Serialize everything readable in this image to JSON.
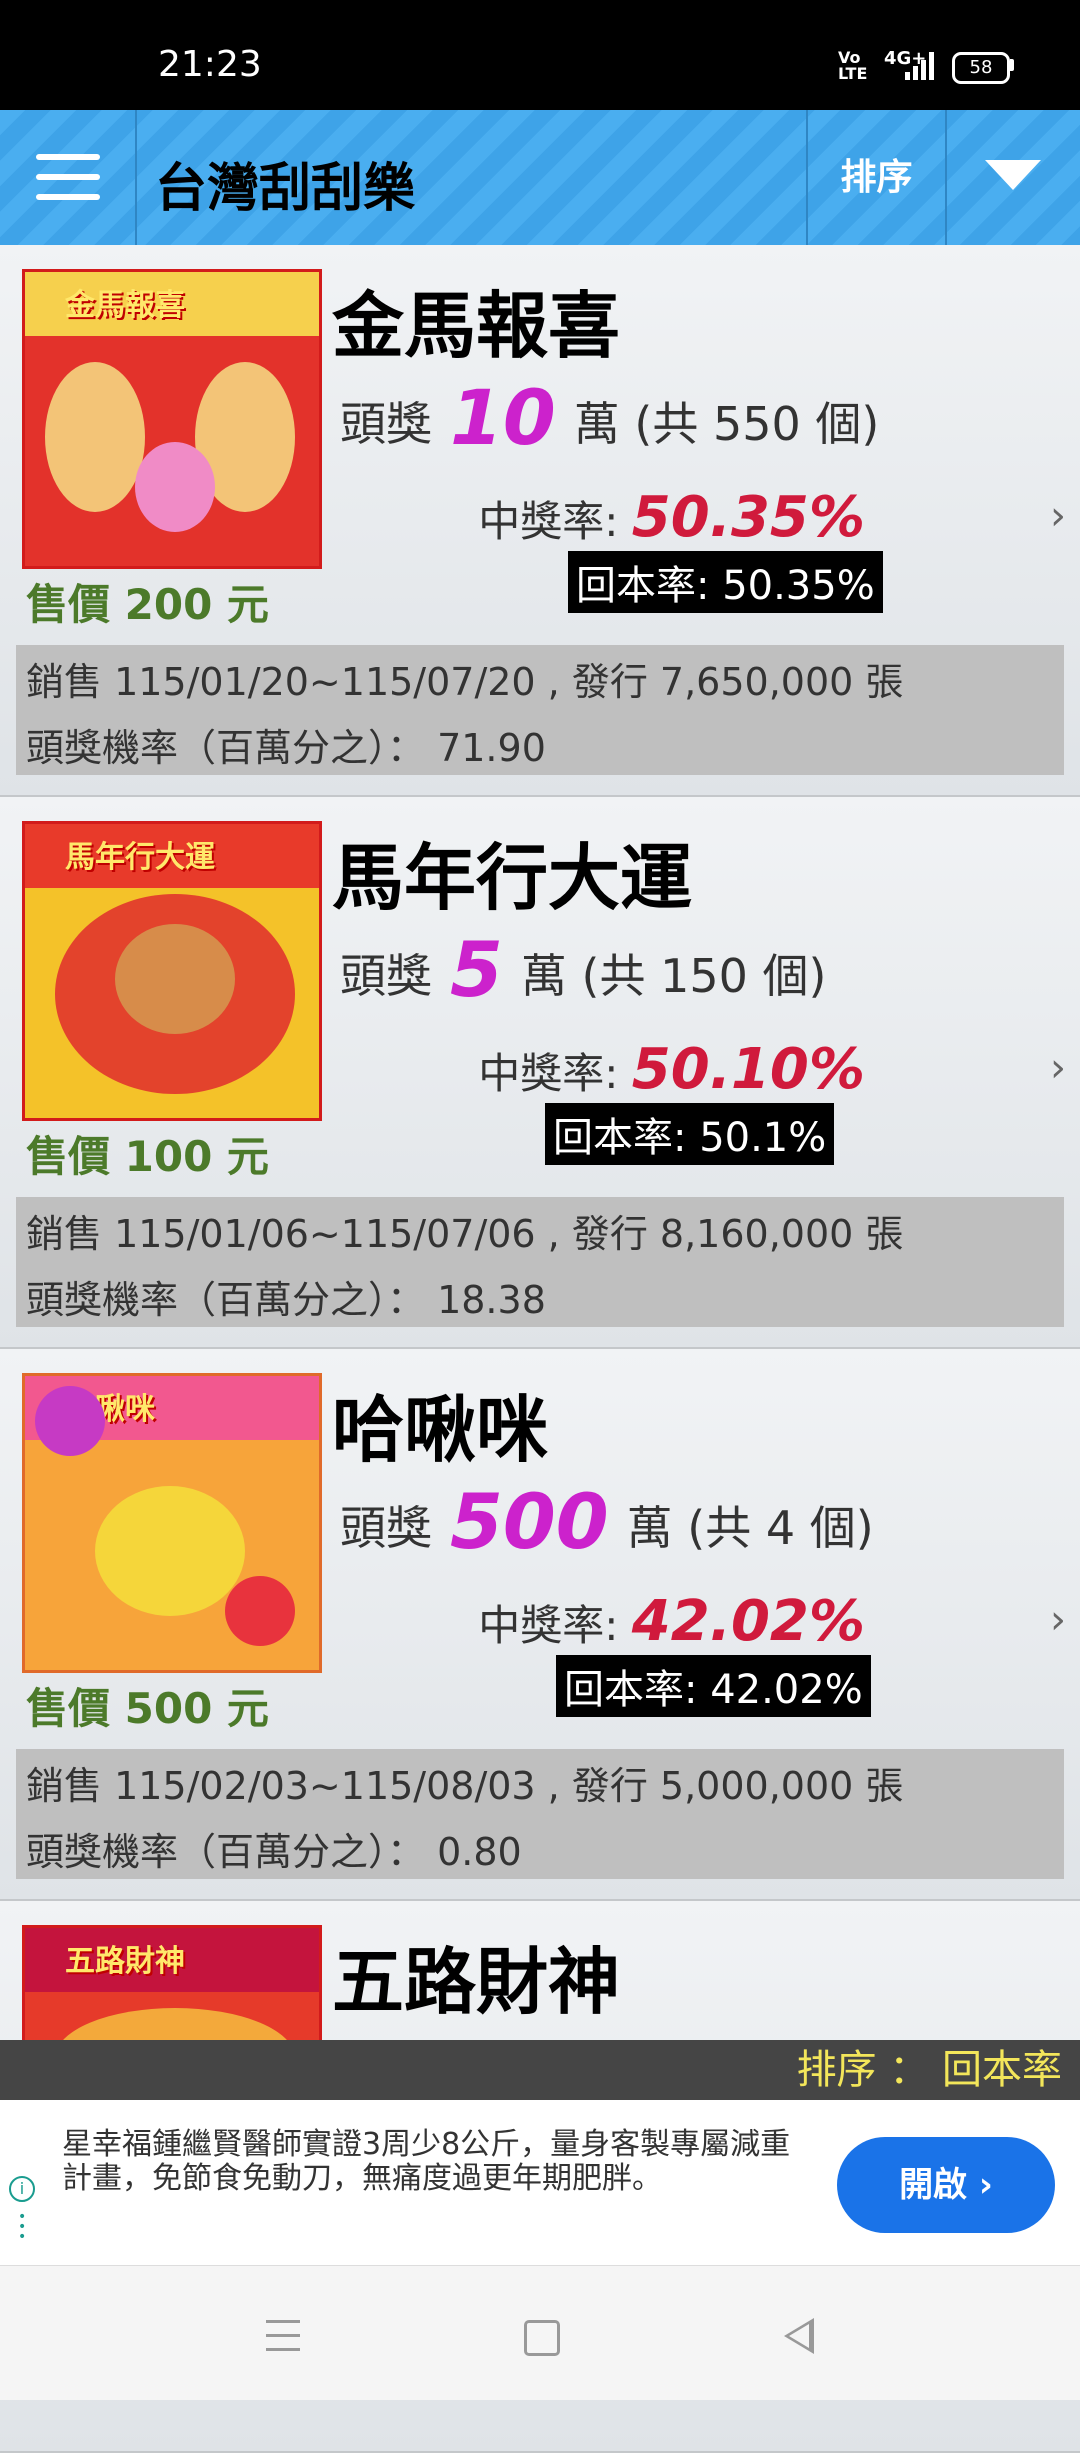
{
  "status_bar": {
    "time": "21:23",
    "network": "4G+",
    "volte": "Vo LTE",
    "battery": "58"
  },
  "header": {
    "title": "台灣刮刮樂",
    "sort_label": "排序",
    "menu_icon": "hamburger-icon",
    "dropdown_icon": "triangle-down-icon"
  },
  "tickets": [
    {
      "name": "金馬報喜",
      "prize_prefix": "頭獎",
      "prize_amount": "10",
      "prize_suffix": "萬 (共 550 個)",
      "win_rate_label": "中獎率:",
      "win_rate": "50.35%",
      "roi": "回本率: 50.35%",
      "price": "售價 200 元",
      "sale_info": "銷售 115/01/20~115/07/20 , 發行 7,650,000 張",
      "odds_info": "頭獎機率（百萬分之）： 71.90",
      "thumb_label": "金馬報喜"
    },
    {
      "name": "馬年行大運",
      "prize_prefix": "頭獎",
      "prize_amount": "5",
      "prize_suffix": "萬 (共 150 個)",
      "win_rate_label": "中獎率:",
      "win_rate": "50.10%",
      "roi": "回本率: 50.1%",
      "price": "售價 100 元",
      "sale_info": "銷售 115/01/06~115/07/06 , 發行 8,160,000 張",
      "odds_info": "頭獎機率（百萬分之）： 18.38",
      "thumb_label": "馬年行大運"
    },
    {
      "name": "哈啾咪",
      "prize_prefix": "頭獎",
      "prize_amount": "500",
      "prize_suffix": "萬 (共 4 個)",
      "win_rate_label": "中獎率:",
      "win_rate": "42.02%",
      "roi": "回本率: 42.02%",
      "price": "售價 500 元",
      "sale_info": "銷售 115/02/03~115/08/03 , 發行 5,000,000 張",
      "odds_info": "頭獎機率（百萬分之）： 0.80",
      "thumb_label": "哈啾咪"
    },
    {
      "name": "五路財神",
      "thumb_label": "五路財神"
    }
  ],
  "sort_footer": "排序 ： 回本率",
  "ad": {
    "text": "星幸福鍾繼賢醫師實證3周少8公斤，量身客製專屬減重計畫，免節食免動刀，無痛度過更年期肥胖。",
    "button": "開啟",
    "icon": "info-icon"
  },
  "nav": {
    "menu_icon": "recent-apps-icon",
    "home_icon": "home-icon",
    "back_icon": "back-icon"
  },
  "colors": {
    "header_blue": "#4aaef0",
    "prize_magenta": "#cc22cc",
    "win_rate_red": "#d01a3c",
    "price_green": "#4c7a2a",
    "footer_yellow": "#f3e65a",
    "ad_button_blue": "#1a73e8"
  }
}
